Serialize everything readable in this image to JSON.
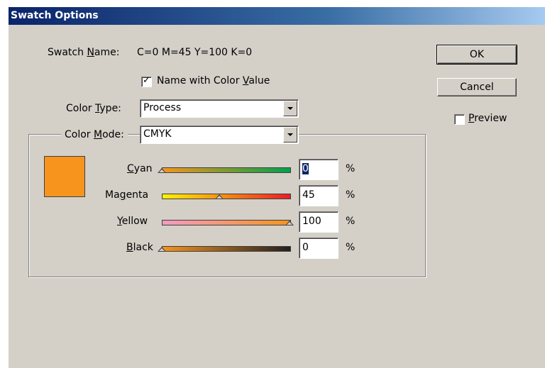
{
  "dialog": {
    "title": "Swatch Options"
  },
  "swatch_name": {
    "label_pre": "Swatch ",
    "label_key": "N",
    "label_post": "ame:",
    "value": "C=0 M=45 Y=100 K=0"
  },
  "name_with_color_value": {
    "checked": true,
    "label_pre": "Name with Color ",
    "label_key": "V",
    "label_post": "alue"
  },
  "color_type": {
    "label_pre": "Color ",
    "label_key": "T",
    "label_post": "ype:",
    "value": "Process"
  },
  "color_mode": {
    "label_pre": "Color ",
    "label_key": "M",
    "label_post": "ode:",
    "value": "CMYK"
  },
  "buttons": {
    "ok": "OK",
    "cancel": "Cancel"
  },
  "preview": {
    "checked": false,
    "label_key": "P",
    "label_post": "review"
  },
  "swatch_color": "#f7941d",
  "channels": [
    {
      "key": "C",
      "rest": "yan",
      "value": "0",
      "level": 0,
      "gradient": "linear-gradient(90deg,#f7941d,#00a14b)"
    },
    {
      "key": "",
      "pre": "Ma",
      "keymid": "g",
      "rest": "enta",
      "value": "45",
      "level": 45,
      "gradient": "linear-gradient(90deg,#fff200,#ed1c24)"
    },
    {
      "key": "Y",
      "rest": "ellow",
      "value": "100",
      "level": 100,
      "gradient": "linear-gradient(90deg,#f49ac1,#f7941d)"
    },
    {
      "key": "B",
      "rest": "lack",
      "value": "0",
      "level": 0,
      "gradient": "linear-gradient(90deg,#f7941d,#231f20)"
    }
  ],
  "percent_sign": "%"
}
